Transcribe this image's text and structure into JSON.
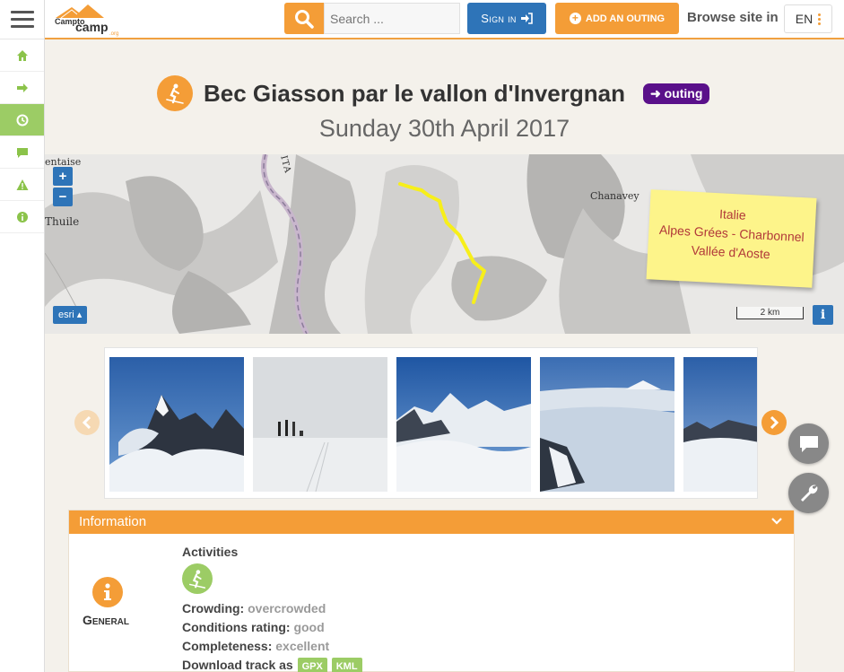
{
  "header": {
    "logo_text": "Camptocamp.org",
    "search_placeholder": "Search ...",
    "signin_label": "Sign in",
    "add_outing_label": "ADD AN OUTING",
    "browse_label": "Browse site in",
    "lang": "EN"
  },
  "sidebar": {
    "items": [
      {
        "icon": "home-icon"
      },
      {
        "icon": "arrow-right-icon"
      },
      {
        "icon": "clock-icon",
        "active": true
      },
      {
        "icon": "comment-icon"
      },
      {
        "icon": "warning-icon"
      },
      {
        "icon": "info-icon"
      }
    ]
  },
  "page": {
    "title": "Bec Giasson par le vallon d'Invergnan",
    "badge": "outing",
    "date": "Sunday 30th April 2017"
  },
  "map": {
    "labels": {
      "tarentaise": "entaise",
      "thuile": "Thuile",
      "ita": "ITA",
      "chanavey": "Chanavey"
    },
    "note_lines": [
      "Italie",
      "Alpes Grées - Charbonnel",
      "Vallée d'Aoste"
    ],
    "esri_label": "esri",
    "scale_label": "2 km",
    "zoom_in": "+",
    "zoom_out": "−",
    "info_label": "i",
    "track_color": "#f7ef1a"
  },
  "info": {
    "header": "Information",
    "section_label": "General",
    "activities_label": "Activities",
    "crowding_label": "Crowding:",
    "crowding_value": "overcrowded",
    "conditions_label": "Conditions rating:",
    "conditions_value": "good",
    "completeness_label": "Completeness:",
    "completeness_value": "excellent",
    "download_label": "Download track as",
    "gpx": "GPX",
    "kml": "KML"
  },
  "colors": {
    "accent": "#f49d37",
    "primary": "#2e74b8",
    "badge": "#5a108a",
    "green": "#9ccc65"
  }
}
